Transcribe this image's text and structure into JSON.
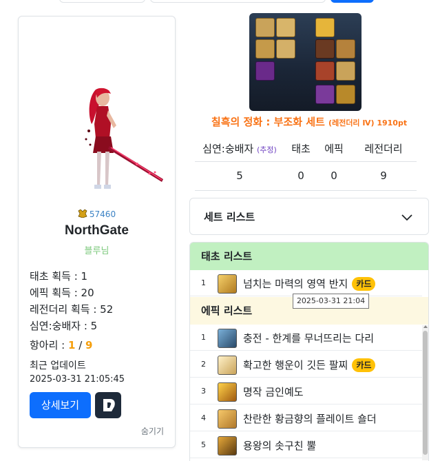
{
  "character": {
    "score": "57460",
    "name": "NorthGate",
    "adventure": "블루님",
    "stats": [
      "태초 획득 : 1",
      "에픽 획득 : 20",
      "레전더리 획득 : 52",
      "심연:숭배자 : 5"
    ],
    "hangari_label": "항아리 : ",
    "hangari_value": "1",
    "hangari_sep": " / ",
    "hangari_total": "9",
    "update_label": "최근 업데이트",
    "update_time": "2025-03-31 21:05:45",
    "detail_button": "상세보기",
    "hide_link": "숨기기"
  },
  "set": {
    "title": "칠흑의 정화 : 부조화 세트 ",
    "title_sub": "(레전더리 Ⅳ) 1910pt",
    "table_headers": [
      "심연:숭배자 ",
      "태초",
      "에픽",
      "레전더리"
    ],
    "estimate_tag": "(추정)",
    "table_values": [
      "5",
      "0",
      "0",
      "9"
    ],
    "set_list_label": "세트 리스트"
  },
  "sections": {
    "taecho": "태초 리스트",
    "epic": "에픽 리스트"
  },
  "taecho_items": [
    {
      "num": "1",
      "name": "넘치는 마력의 영역 반지",
      "badge": "카드"
    }
  ],
  "epic_items": [
    {
      "num": "1",
      "name": "충전 - 한계를 무너뜨리는 다리",
      "badge": ""
    },
    {
      "num": "2",
      "name": "확고한 행운이 깃든 팔찌",
      "badge": "카드"
    },
    {
      "num": "3",
      "name": "명작 금인예도",
      "badge": ""
    },
    {
      "num": "4",
      "name": "찬란한 황금향의 플레이트 숄더",
      "badge": ""
    },
    {
      "num": "5",
      "name": "용왕의 솟구친 뿔",
      "badge": ""
    }
  ],
  "tooltip": "2025-03-31 21:04",
  "colors": {
    "accent": "#0d6efd",
    "set_title": "#f97316",
    "taecho_bg": "#c1f0c1",
    "epic_bg": "#fdf8e1",
    "badge": "#ffc107"
  }
}
